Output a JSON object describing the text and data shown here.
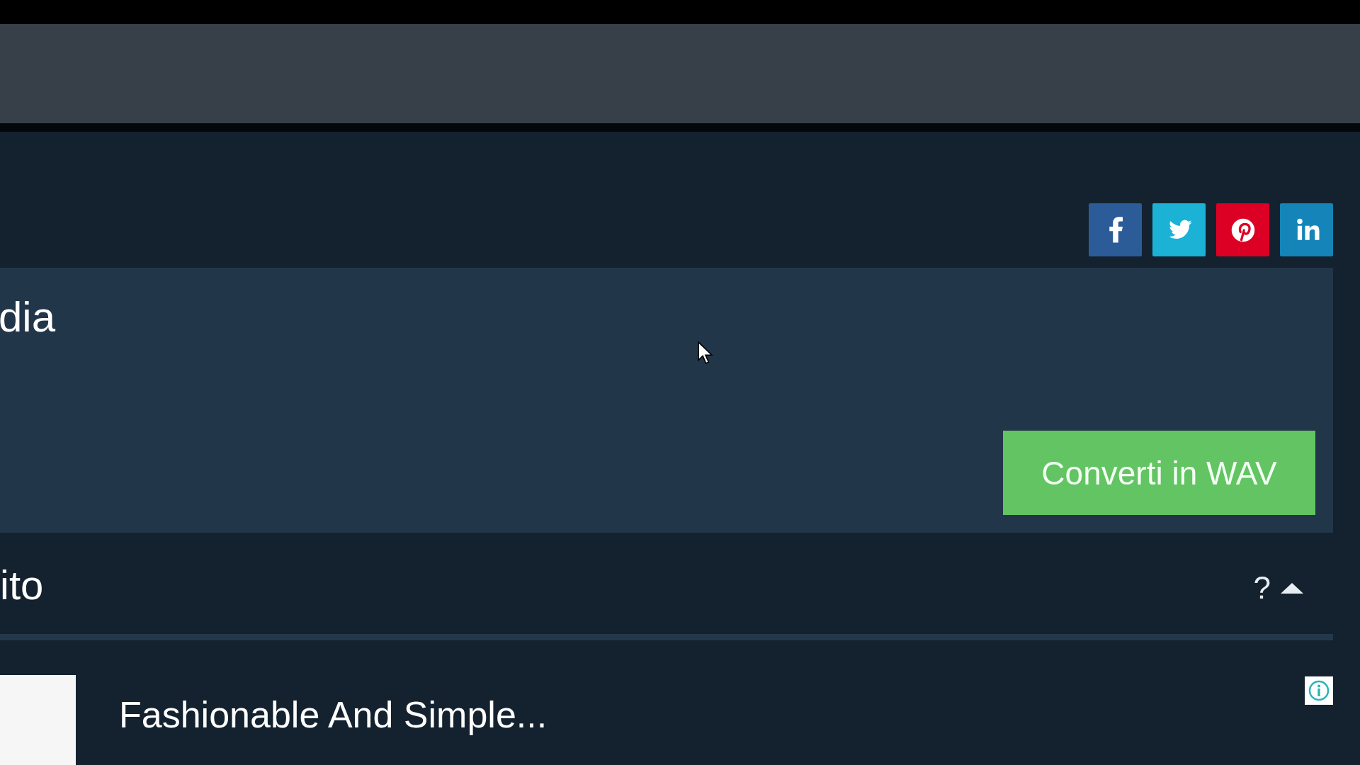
{
  "social_buttons": [
    {
      "kind": "facebook",
      "color": "#2b5c98"
    },
    {
      "kind": "twitter",
      "color": "#1bb2d6"
    },
    {
      "kind": "pinterest",
      "color": "#dc0024"
    },
    {
      "kind": "linkedin",
      "color": "#1584b8"
    }
  ],
  "converter": {
    "title": "dia",
    "button": "Converti in WAV"
  },
  "section": {
    "title": "ito",
    "help": "?",
    "expanded": true
  },
  "ad": {
    "title": "Fashionable And Simple..."
  }
}
